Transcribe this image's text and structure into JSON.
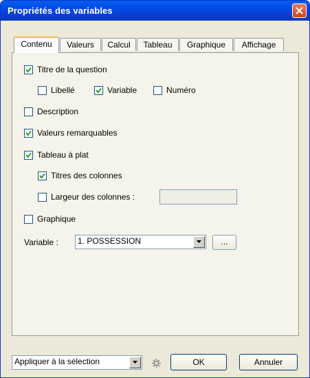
{
  "window": {
    "title": "Propriétés des variables"
  },
  "tabs": [
    "Contenu",
    "Valeurs",
    "Calcul",
    "Tableau",
    "Graphique",
    "Affichage"
  ],
  "active_tab": "Contenu",
  "options": {
    "titre_question": {
      "label": "Titre de la question",
      "checked": true
    },
    "libelle": {
      "label": "Libellé",
      "checked": false
    },
    "variable": {
      "label": "Variable",
      "checked": true
    },
    "numero": {
      "label": "Numéro",
      "checked": false
    },
    "description": {
      "label": "Description",
      "checked": false
    },
    "valeurs_remarquables": {
      "label": "Valeurs remarquables",
      "checked": true
    },
    "tableau_plat": {
      "label": "Tableau à plat",
      "checked": true
    },
    "titres_colonnes": {
      "label": "Titres des colonnes",
      "checked": true
    },
    "largeur_colonnes": {
      "label": "Largeur des colonnes :",
      "checked": false,
      "value": ""
    },
    "graphique": {
      "label": "Graphique",
      "checked": false
    }
  },
  "variable_select": {
    "label": "Variable :",
    "value": "1. POSSESSION",
    "browse_label": "..."
  },
  "bottom": {
    "apply_select": "Appliquer à la sélection",
    "ok_label": "OK",
    "cancel_label": "Annuler"
  }
}
